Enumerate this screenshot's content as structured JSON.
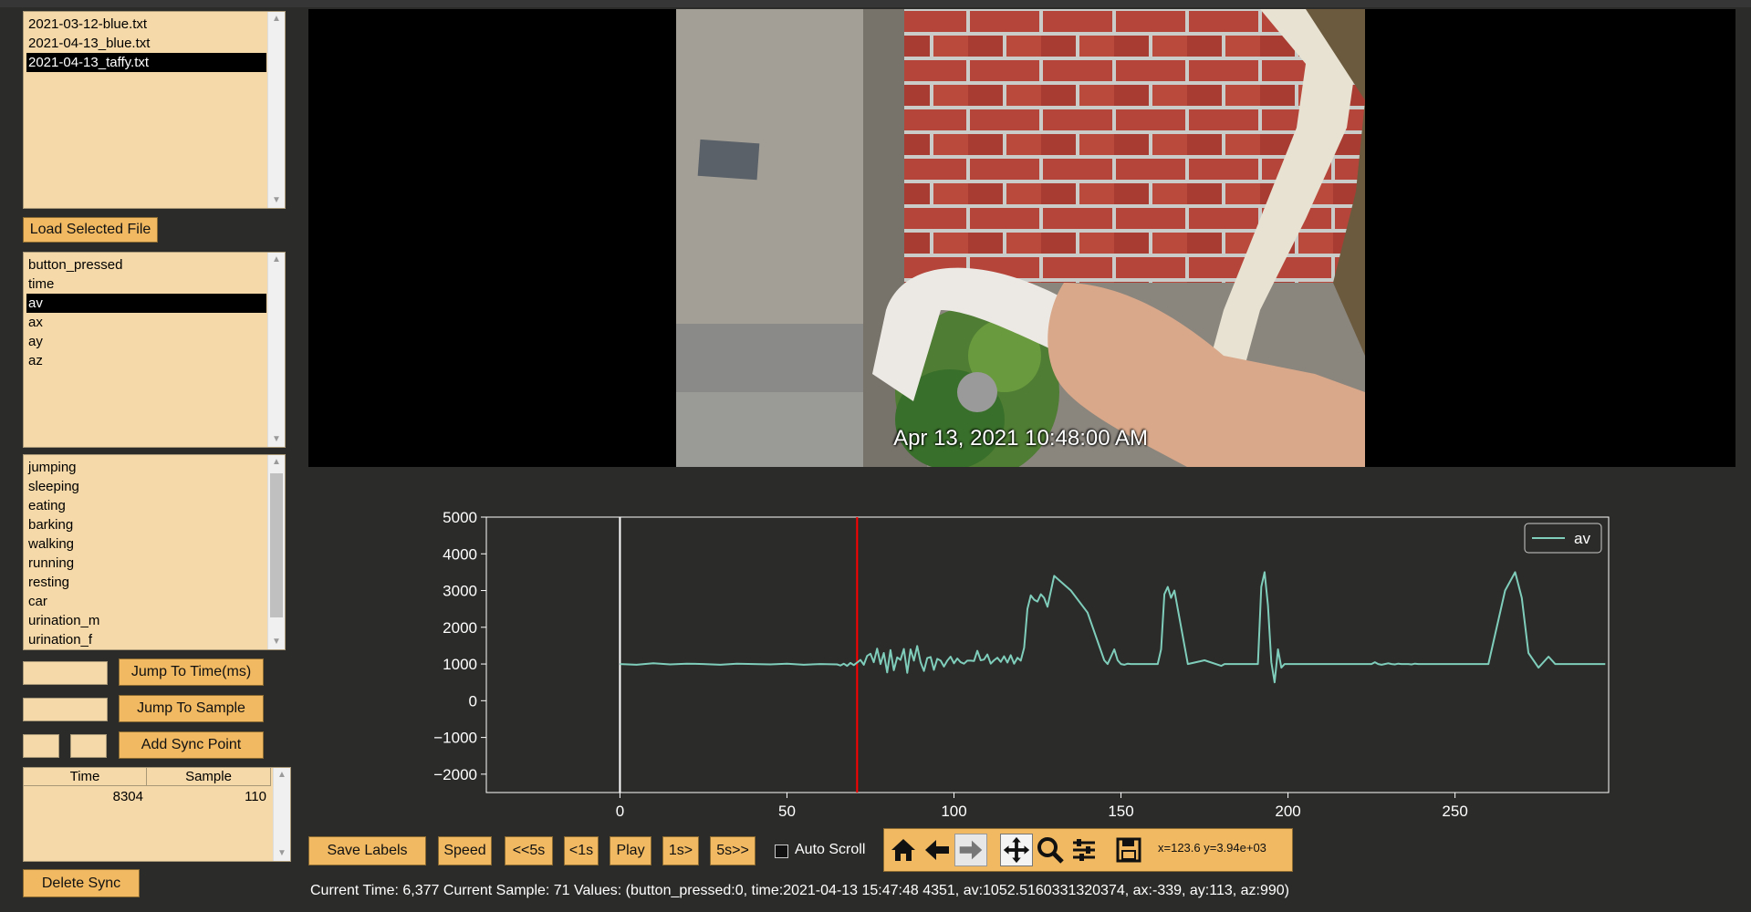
{
  "files": {
    "items": [
      "2021-03-12-blue.txt",
      "2021-04-13_blue.txt",
      "2021-04-13_taffy.txt"
    ],
    "selected": "2021-04-13_taffy.txt"
  },
  "load_button": "Load Selected File",
  "columns": {
    "items": [
      "button_pressed",
      "time",
      "av",
      "ax",
      "ay",
      "az"
    ],
    "selected": "av"
  },
  "labels": {
    "items": [
      "jumping",
      "sleeping",
      "eating",
      "barking",
      "walking",
      "running",
      "resting",
      "car",
      "urination_m",
      "urination_f"
    ]
  },
  "jump_time_button": "Jump To Time(ms)",
  "jump_sample_button": "Jump To Sample",
  "add_sync_button": "Add Sync Point",
  "sync_table": {
    "headers": [
      "Time",
      "Sample"
    ],
    "rows": [
      [
        "8304",
        "110"
      ]
    ]
  },
  "delete_sync_button": "Delete Sync",
  "video": {
    "timestamp": "Apr 13, 2021 10:48:00 AM"
  },
  "controls": {
    "save_labels": "Save Labels",
    "speed": "Speed",
    "back5": "<<5s",
    "back1": "<1s",
    "play": "Play",
    "fwd1": "1s>",
    "fwd5": "5s>>",
    "auto_scroll": "Auto Scroll",
    "auto_scroll_checked": false
  },
  "toolbar": {
    "icons": [
      "home-icon",
      "back-arrow-icon",
      "forward-arrow-icon",
      "pan-icon",
      "zoom-icon",
      "configure-icon",
      "save-icon"
    ],
    "coords": "x=123.6 y=3.94e+03"
  },
  "status": "Current Time: 6,377 Current Sample: 71   Values: (button_pressed:0, time:2021-04-13 15:47:48 4351, av:1052.5160331320374, ax:-339, ay:113, az:990)",
  "chart_data": {
    "type": "line",
    "series": [
      {
        "name": "av",
        "color": "#7fcdbb",
        "x": [
          0,
          5,
          10,
          15,
          20,
          25,
          30,
          35,
          40,
          45,
          50,
          55,
          60,
          65,
          66,
          67,
          68,
          69,
          70,
          71,
          72,
          73,
          74,
          75,
          76,
          77,
          78,
          79,
          80,
          81,
          82,
          83,
          84,
          85,
          86,
          87,
          88,
          89,
          90,
          91,
          92,
          93,
          94,
          95,
          96,
          97,
          98,
          99,
          100,
          101,
          102,
          103,
          104,
          105,
          106,
          107,
          108,
          109,
          110,
          111,
          112,
          113,
          114,
          115,
          116,
          117,
          118,
          119,
          120,
          121,
          122,
          123,
          124,
          125,
          126,
          127,
          128,
          130,
          135,
          140,
          145,
          146,
          147,
          148,
          149,
          150,
          151,
          152,
          153,
          154,
          155,
          156,
          157,
          158,
          159,
          160,
          161,
          162,
          163,
          164,
          165,
          166,
          170,
          175,
          180,
          181,
          182,
          183,
          184,
          185,
          186,
          187,
          188,
          189,
          190,
          191,
          192,
          193,
          194,
          195,
          196,
          197,
          198,
          199,
          200,
          205,
          210,
          215,
          220,
          225,
          226,
          227,
          228,
          229,
          230,
          231,
          232,
          233,
          234,
          235,
          236,
          237,
          238,
          239,
          240,
          241,
          242,
          243,
          244,
          245,
          246,
          247,
          248,
          250,
          255,
          260,
          265,
          268,
          270,
          272,
          275,
          278,
          280,
          282,
          285,
          287,
          290,
          292,
          295
        ],
        "y": [
          1000,
          980,
          1020,
          990,
          1010,
          1000,
          980,
          1010,
          1000,
          990,
          1010,
          980,
          1000,
          990,
          960,
          1010,
          950,
          1030,
          970,
          1040,
          1110,
          980,
          1220,
          1280,
          1050,
          1420,
          1000,
          1300,
          770,
          1380,
          830,
          1180,
          1110,
          1410,
          760,
          1400,
          1090,
          1490,
          1050,
          810,
          1160,
          1190,
          840,
          1140,
          1090,
          930,
          1090,
          1200,
          1020,
          1150,
          1050,
          1010,
          1090,
          1090,
          1080,
          1360,
          1100,
          1120,
          1260,
          1010,
          1100,
          1170,
          1060,
          1210,
          1040,
          1240,
          1010,
          1170,
          1090,
          1440,
          2500,
          2870,
          2750,
          2700,
          2900,
          2800,
          2560,
          3400,
          3000,
          2400,
          1100,
          1000,
          1200,
          1400,
          1100,
          1000,
          980,
          1010,
          1000,
          1000,
          1000,
          1000,
          1000,
          1000,
          1000,
          1000,
          1000,
          1400,
          2900,
          3100,
          2800,
          3000,
          1000,
          1100,
          950,
          1000,
          1000,
          1000,
          1000,
          1000,
          1000,
          1000,
          1000,
          1000,
          1000,
          1000,
          3100,
          3500,
          2600,
          1050,
          500,
          1400,
          900,
          1000,
          1000,
          1000,
          1000,
          1000,
          1000,
          1000,
          1050,
          1000,
          980,
          1000,
          1020,
          1000,
          990,
          1010,
          1000,
          1000,
          1000,
          990,
          1010,
          1000,
          1000,
          1000,
          1000,
          1000,
          1000,
          1000,
          1000,
          1000,
          1000,
          1000,
          1000,
          1000,
          3000,
          3500,
          2800,
          1300,
          900,
          1200,
          1000,
          1000,
          1000,
          1000,
          1000,
          1000,
          1000
        ]
      }
    ],
    "xlim": [
      -40,
      296
    ],
    "ylim": [
      -2500,
      5000
    ],
    "xticks": [
      0,
      50,
      100,
      150,
      200,
      250
    ],
    "yticks": [
      5000,
      4000,
      3000,
      2000,
      1000,
      0,
      -1000,
      -2000
    ],
    "markers": [
      {
        "x": 0,
        "color": "#ffffff"
      },
      {
        "x": 71,
        "color": "#ff0000"
      }
    ],
    "legend": "top-right",
    "grid": false
  }
}
